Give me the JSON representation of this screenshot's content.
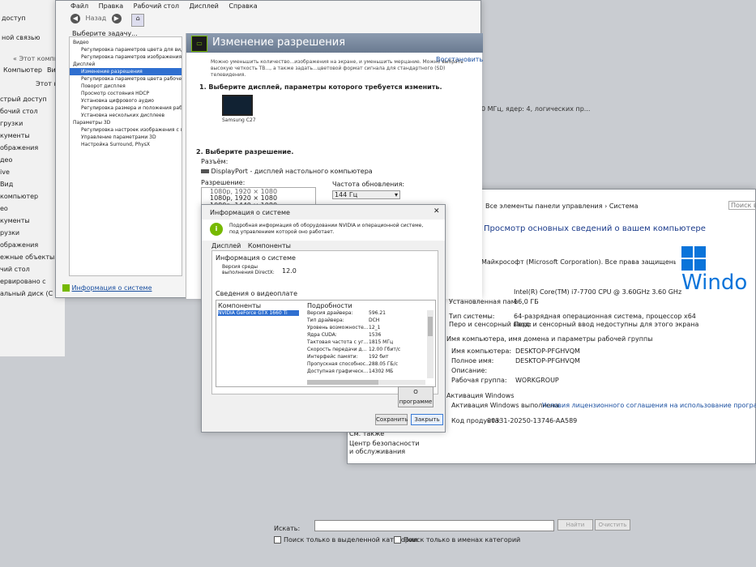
{
  "explorer": {
    "top_lines": [
      "доступ",
      "ной связью"
    ],
    "address": "Этот компьютер",
    "address_prefix": "« Этот компьют",
    "col_computer": "Компьютер",
    "col_view": "Вид",
    "this_pc_label": "Этот ком",
    "nav": [
      "стрый доступ",
      "бочий стол",
      "грузки",
      "кументы",
      "ображения",
      "део",
      "ive",
      "Вид",
      "компьютер",
      "ео",
      "кументы",
      "рузки",
      "ображения",
      "ежные объекты",
      "чий стол",
      "ервировано с",
      "альный диск (С"
    ]
  },
  "nvidia": {
    "menu": [
      "Файл",
      "Правка",
      "Рабочий стол",
      "Дисплей",
      "Справка"
    ],
    "back_label": "Назад",
    "choose_task": "Выберите задачу...",
    "tree": [
      {
        "label": "Видео",
        "level": 0
      },
      {
        "label": "Регулировка параметров цвета для вид",
        "level": 1
      },
      {
        "label": "Регулировка параметров изображения д",
        "level": 1
      },
      {
        "label": "Дисплей",
        "level": 0
      },
      {
        "label": "Изменение разрешения",
        "level": 1,
        "selected": true
      },
      {
        "label": "Регулировка параметров цвета рабоче",
        "level": 1
      },
      {
        "label": "Поворот дисплея",
        "level": 1
      },
      {
        "label": "Просмотр состояния HDCP",
        "level": 1
      },
      {
        "label": "Установка цифрового аудио",
        "level": 1
      },
      {
        "label": "Регулировка размера и положения рабо",
        "level": 1
      },
      {
        "label": "Установка нескольких дисплеев",
        "level": 1
      },
      {
        "label": "Параметры 3D",
        "level": 0
      },
      {
        "label": "Регулировка настроек изображения с п",
        "level": 1
      },
      {
        "label": "Управление параметрами 3D",
        "level": 1
      },
      {
        "label": "Настройка Surround, PhysX",
        "level": 1
      }
    ],
    "sysinfo_link": "Информация о системе",
    "page_title": "Изменение разрешения",
    "restore": "Восстановить",
    "description": "Можно уменьшить количество...изображения на экране, и уменьшить мерцание. Можно выбрать высокую четкость ТВ..., а также задать...цветовой формат сигнала для стандартного (SD) телевидения.",
    "step1": "1. Выберите дисплей, параметры которого требуется изменить.",
    "monitor_label": "Samsung C27...",
    "step2": "2. Выберите разрешение.",
    "connector_label": "Разъём:",
    "connector_value": "DisplayPort - дисплей настольного компьютера",
    "resolution_label": "Разрешение:",
    "resolutions": [
      "1080р, 1920 × 1080",
      "1080р, 1920 × 1080",
      "1080р, 1440 × 1080"
    ],
    "refresh_label": "Частота обновления:",
    "refresh_value": "144 Гц"
  },
  "dialog": {
    "title": "Информация о системе",
    "intro": "Подробная информация об оборудовании NVIDIA и операционной системе, под управлением которой оно работает.",
    "tabs": [
      "Дисплей",
      "Компоненты"
    ],
    "sys_info_heading": "Информация о системе",
    "directx_label": "Версия среды выполнения DirectX:",
    "directx_value": "12.0",
    "card_heading": "Сведения о видеоплате",
    "components_header": "Компоненты",
    "details_header": "Подробности",
    "gpu": "NVIDIA GeForce GTX 1660 Ti",
    "details": [
      {
        "k": "Версия драйвера:",
        "v": "596.21"
      },
      {
        "k": "Тип драйвера:",
        "v": "DCH"
      },
      {
        "k": "Уровень возможносте...",
        "v": "12_1"
      },
      {
        "k": "Ядра CUDA:",
        "v": "1536"
      },
      {
        "k": "Тактовая частота с уг...",
        "v": "1815 МГц"
      },
      {
        "k": "Скорость передачи д...",
        "v": "12.00 Гбит/с"
      },
      {
        "k": "Интерфейс памяти:",
        "v": "192 бит"
      },
      {
        "k": "Пропускная способнос...",
        "v": "288.05 ГБ/с"
      },
      {
        "k": "Доступная графическ...",
        "v": "14302 МБ"
      }
    ],
    "about_button": "О программе",
    "save_button": "Сохранить",
    "close_button": "Закрыть"
  },
  "system": {
    "breadcrumb": "Все элементы панели управления  ›  Система",
    "search_placeholder": "Поиск в",
    "heading": "Просмотр основных сведений о вашем компьютере",
    "cpu_line": "0 МГц, ядер: 4, логических пр...",
    "copyright": "Майкрософт (Microsoft Corporation). Все права защищены.",
    "processor_value": "Intel(R) Core(TM) i7-7700 CPU @ 3.60GHz   3.60 GHz",
    "ram_label": "Установленная память (ОЗУ):",
    "ram_value": "16,0 ГБ",
    "systype_label": "Тип системы:",
    "systype_value": "64-разрядная операционная система, процессор x64",
    "pen_label": "Перо и сенсорный ввод:",
    "pen_value": "Перо и сенсорный ввод недоступны для этого экрана",
    "name_section": "Имя компьютера, имя домена и параметры рабочей группы",
    "computer_name_label": "Имя компьютера:",
    "computer_name_value": "DESKTOP-PFGHVQM",
    "full_name_label": "Полное имя:",
    "full_name_value": "DESKTOP-PFGHVQM",
    "desc_label": "Описание:",
    "workgroup_label": "Рабочая группа:",
    "workgroup_value": "WORKGROUP",
    "activation_section": "Активация Windows",
    "activation_status": "Активация Windows выполнена",
    "license_link": "Условия лицензионного соглашения на использование программного обеспечения корпорации",
    "product_code_label": "Код продукта:",
    "product_code_value": "00331-20250-13746-AA589",
    "see_also": "См. также",
    "security_center": "Центр безопасности и обслуживания",
    "windows_logo_text": "Windo"
  },
  "bottom": {
    "search_label": "Искать:",
    "find_button": "Найти",
    "clear_button": "Очистить",
    "opt1": "Поиск только в выделенной категории",
    "opt2": "Поиск только в именах категорий"
  },
  "colors": {
    "accent": "#2f6fd0",
    "nvidia_green": "#76b900",
    "win_blue": "#0a74da"
  }
}
